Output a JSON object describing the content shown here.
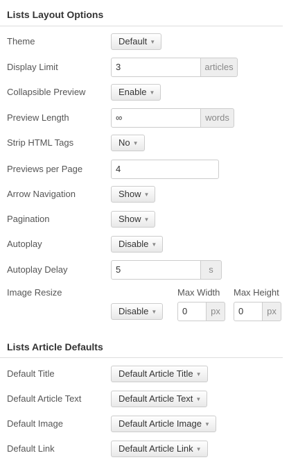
{
  "layout_options": {
    "title": "Lists Layout Options",
    "theme": {
      "label": "Theme",
      "value": "Default"
    },
    "display_limit": {
      "label": "Display Limit",
      "value": "3",
      "unit": "articles"
    },
    "collapsible_preview": {
      "label": "Collapsible Preview",
      "value": "Enable"
    },
    "preview_length": {
      "label": "Preview Length",
      "value": "∞",
      "unit": "words"
    },
    "strip_html": {
      "label": "Strip HTML Tags",
      "value": "No"
    },
    "previews_per_page": {
      "label": "Previews per Page",
      "value": "4"
    },
    "arrow_navigation": {
      "label": "Arrow Navigation",
      "value": "Show"
    },
    "pagination": {
      "label": "Pagination",
      "value": "Show"
    },
    "autoplay": {
      "label": "Autoplay",
      "value": "Disable"
    },
    "autoplay_delay": {
      "label": "Autoplay Delay",
      "value": "5",
      "unit": "s"
    },
    "image_resize": {
      "label": "Image Resize",
      "value": "Disable",
      "max_width_label": "Max Width",
      "max_width_value": "0",
      "max_height_label": "Max Height",
      "max_height_value": "0",
      "unit": "px"
    }
  },
  "article_defaults": {
    "title": "Lists Article Defaults",
    "default_title": {
      "label": "Default Title",
      "value": "Default Article Title"
    },
    "default_text": {
      "label": "Default Article Text",
      "value": "Default Article Text"
    },
    "default_image": {
      "label": "Default Image",
      "value": "Default Article Image"
    },
    "default_link": {
      "label": "Default Link",
      "value": "Default Article Link"
    }
  },
  "icons": {
    "dropdown_caret": "caret-down-icon"
  }
}
